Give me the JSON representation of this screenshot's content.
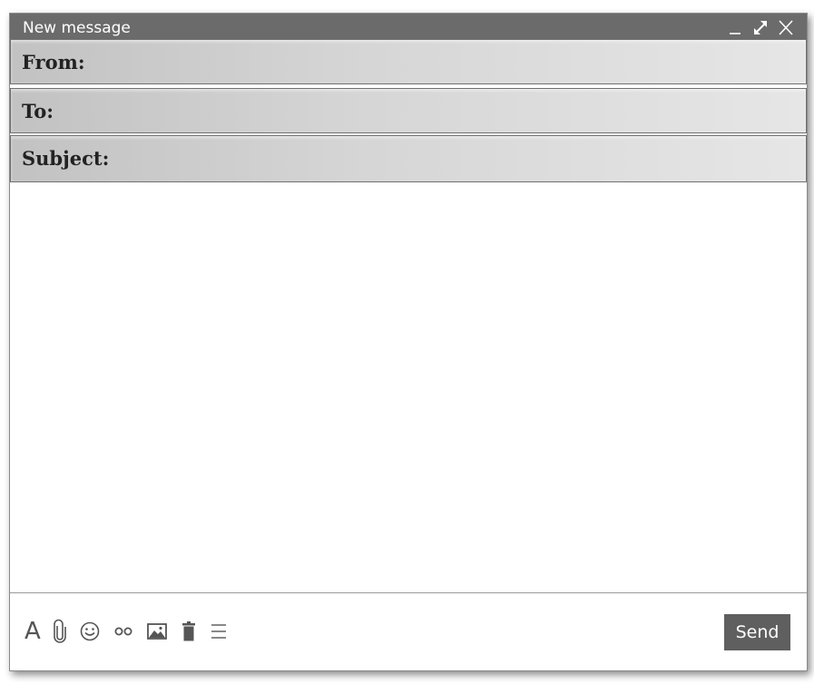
{
  "window": {
    "title": "New message",
    "controls": [
      "minimize-icon",
      "expand-icon",
      "close-icon"
    ]
  },
  "fields": {
    "from_label": "From:",
    "from_value": "",
    "to_label": "To:",
    "to_value": "",
    "subject_label": "Subject:",
    "subject_value": ""
  },
  "body": {
    "text": ""
  },
  "toolbar": {
    "icons": [
      "text-format-icon",
      "attachment-icon",
      "emoji-icon",
      "link-icon",
      "image-icon",
      "trash-icon",
      "more-options-icon"
    ],
    "format_glyph": "A",
    "send_label": "Send"
  },
  "colors": {
    "titlebar": "#6b6b6b",
    "field_gradient_start": "#c2c2c2",
    "field_gradient_end": "#e6e6e6",
    "send_button": "#5f5f5f",
    "icon": "#555555"
  }
}
